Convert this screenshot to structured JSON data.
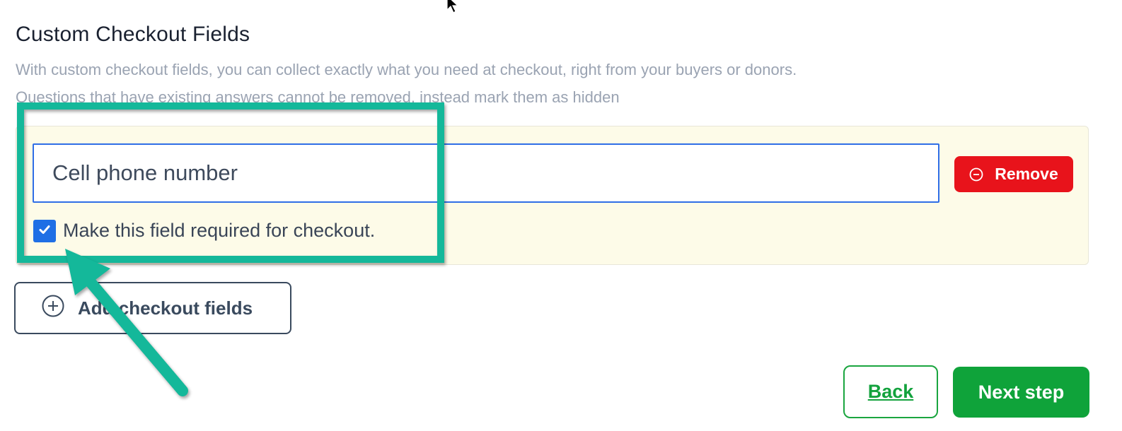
{
  "section": {
    "title": "Custom Checkout Fields",
    "description_1": "With custom checkout fields, you can collect exactly what you need at checkout, right from your buyers or donors.",
    "description_2": "Questions that have existing answers cannot be removed, instead mark them as hidden"
  },
  "field": {
    "value": "Cell phone number",
    "remove_label": "Remove",
    "required_label": "Make this field required for checkout.",
    "required_checked": true
  },
  "actions": {
    "add_label": "Add checkout fields",
    "back_label": "Back",
    "next_label": "Next step"
  },
  "colors": {
    "accent_blue": "#1f6fe5",
    "remove_red": "#e8131b",
    "primary_green": "#0fa33a",
    "annotation_teal": "#14b89a",
    "card_bg": "#fdfbe8"
  },
  "icons": {
    "remove": "minus-circle-icon",
    "add": "plus-circle-icon",
    "check": "check-icon",
    "cursor": "mouse-pointer-icon",
    "annotation_arrow": "arrow-icon"
  }
}
